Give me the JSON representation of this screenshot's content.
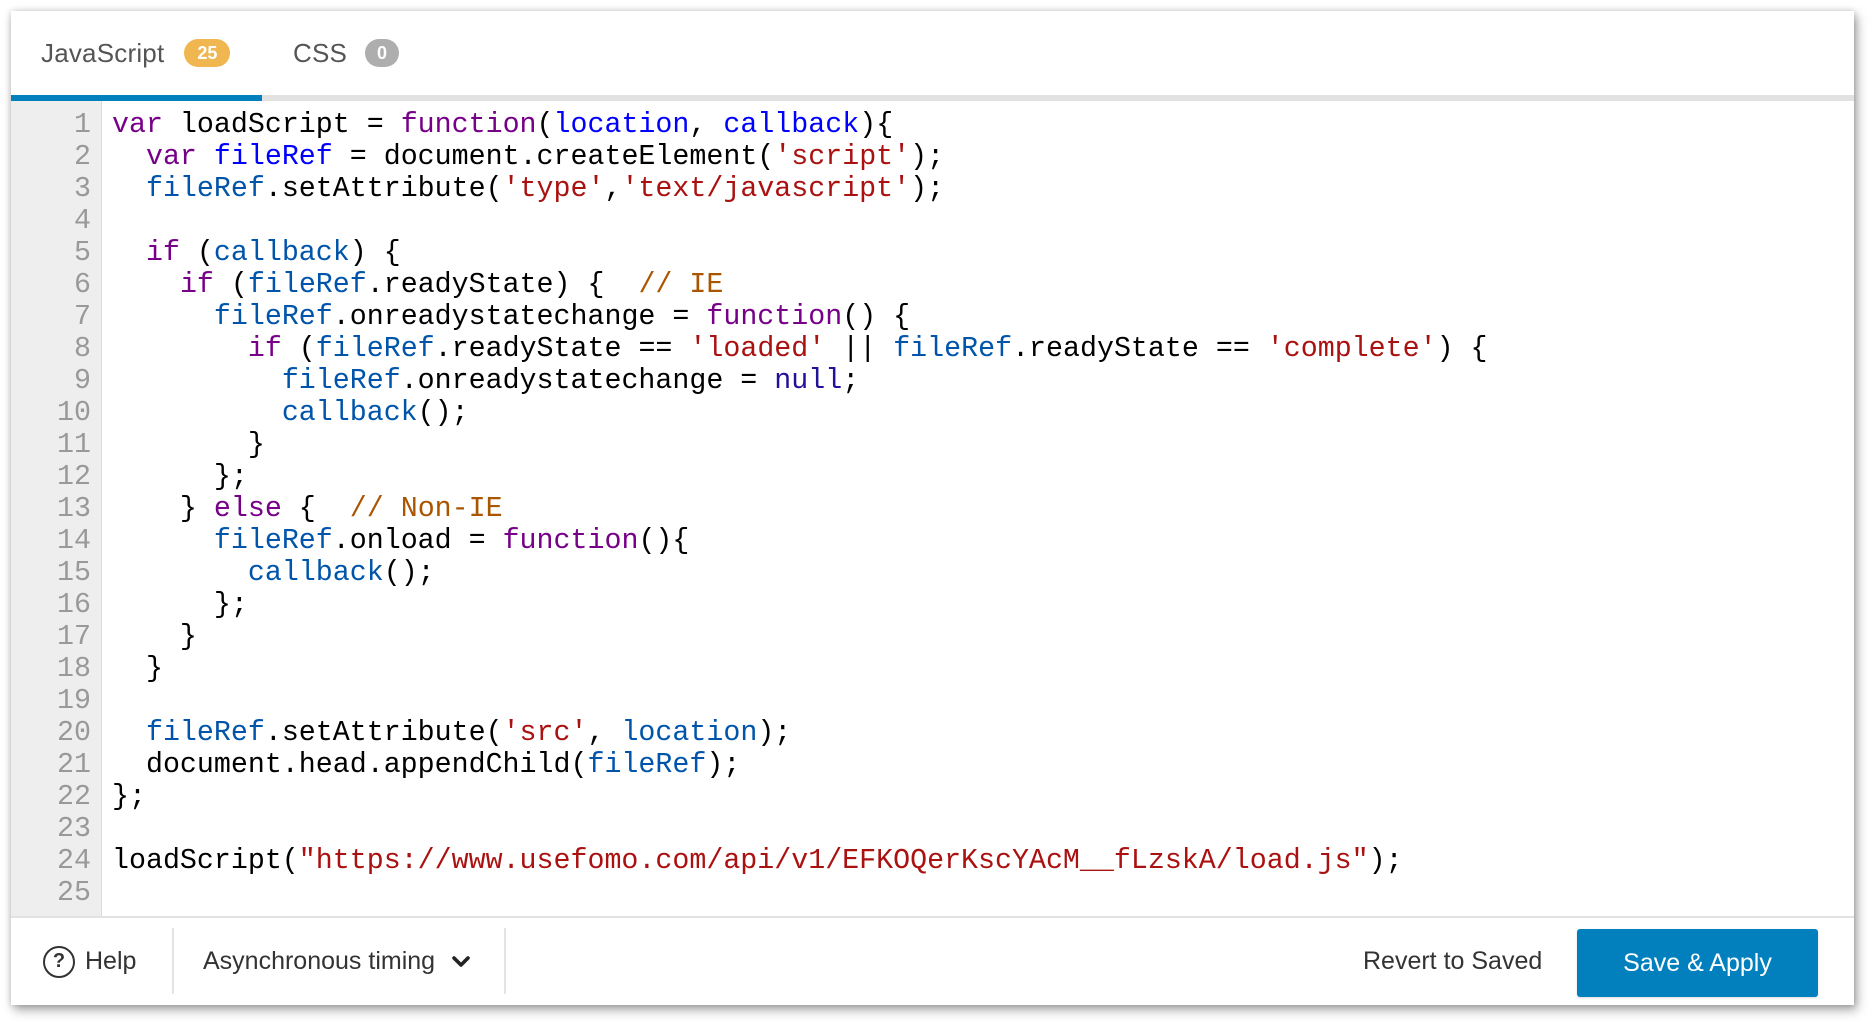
{
  "tabs": [
    {
      "label": "JavaScript",
      "badge": "25",
      "active": true
    },
    {
      "label": "CSS",
      "badge": "0",
      "active": false
    }
  ],
  "colors": {
    "accent": "#0180bd",
    "badge_js": "#f0b64f",
    "badge_css": "#aeaeae",
    "keyword": "#770088",
    "def": "#0000ff",
    "variable2": "#0055aa",
    "string": "#aa1111",
    "comment": "#aa5500",
    "atom": "#221199"
  },
  "editor": {
    "lines": [
      [
        [
          "keyword",
          "var"
        ],
        [
          "plain",
          " loadScript = "
        ],
        [
          "keyword",
          "function"
        ],
        [
          "plain",
          "("
        ],
        [
          "def",
          "location"
        ],
        [
          "plain",
          ", "
        ],
        [
          "def",
          "callback"
        ],
        [
          "plain",
          "){"
        ]
      ],
      [
        [
          "plain",
          "  "
        ],
        [
          "keyword",
          "var"
        ],
        [
          "plain",
          " "
        ],
        [
          "def",
          "fileRef"
        ],
        [
          "plain",
          " = document.createElement("
        ],
        [
          "string",
          "'script'"
        ],
        [
          "plain",
          ");"
        ]
      ],
      [
        [
          "plain",
          "  "
        ],
        [
          "var2",
          "fileRef"
        ],
        [
          "plain",
          ".setAttribute("
        ],
        [
          "string",
          "'type'"
        ],
        [
          "plain",
          ","
        ],
        [
          "string",
          "'text/javascript'"
        ],
        [
          "plain",
          ");"
        ]
      ],
      [],
      [
        [
          "plain",
          "  "
        ],
        [
          "keyword",
          "if"
        ],
        [
          "plain",
          " ("
        ],
        [
          "var2",
          "callback"
        ],
        [
          "plain",
          ") {"
        ]
      ],
      [
        [
          "plain",
          "    "
        ],
        [
          "keyword",
          "if"
        ],
        [
          "plain",
          " ("
        ],
        [
          "var2",
          "fileRef"
        ],
        [
          "plain",
          ".readyState) {  "
        ],
        [
          "comment",
          "// IE"
        ]
      ],
      [
        [
          "plain",
          "      "
        ],
        [
          "var2",
          "fileRef"
        ],
        [
          "plain",
          ".onreadystatechange = "
        ],
        [
          "keyword",
          "function"
        ],
        [
          "plain",
          "() {"
        ]
      ],
      [
        [
          "plain",
          "        "
        ],
        [
          "keyword",
          "if"
        ],
        [
          "plain",
          " ("
        ],
        [
          "var2",
          "fileRef"
        ],
        [
          "plain",
          ".readyState == "
        ],
        [
          "string",
          "'loaded'"
        ],
        [
          "plain",
          " || "
        ],
        [
          "var2",
          "fileRef"
        ],
        [
          "plain",
          ".readyState == "
        ],
        [
          "string",
          "'complete'"
        ],
        [
          "plain",
          ") {"
        ]
      ],
      [
        [
          "plain",
          "          "
        ],
        [
          "var2",
          "fileRef"
        ],
        [
          "plain",
          ".onreadystatechange = "
        ],
        [
          "atom",
          "null"
        ],
        [
          "plain",
          ";"
        ]
      ],
      [
        [
          "plain",
          "          "
        ],
        [
          "var2",
          "callback"
        ],
        [
          "plain",
          "();"
        ]
      ],
      [
        [
          "plain",
          "        }"
        ]
      ],
      [
        [
          "plain",
          "      };"
        ]
      ],
      [
        [
          "plain",
          "    } "
        ],
        [
          "keyword",
          "else"
        ],
        [
          "plain",
          " {  "
        ],
        [
          "comment",
          "// Non-IE"
        ]
      ],
      [
        [
          "plain",
          "      "
        ],
        [
          "var2",
          "fileRef"
        ],
        [
          "plain",
          ".onload = "
        ],
        [
          "keyword",
          "function"
        ],
        [
          "plain",
          "(){"
        ]
      ],
      [
        [
          "plain",
          "        "
        ],
        [
          "var2",
          "callback"
        ],
        [
          "plain",
          "();"
        ]
      ],
      [
        [
          "plain",
          "      };"
        ]
      ],
      [
        [
          "plain",
          "    }"
        ]
      ],
      [
        [
          "plain",
          "  }"
        ]
      ],
      [],
      [
        [
          "plain",
          "  "
        ],
        [
          "var2",
          "fileRef"
        ],
        [
          "plain",
          ".setAttribute("
        ],
        [
          "string",
          "'src'"
        ],
        [
          "plain",
          ", "
        ],
        [
          "var2",
          "location"
        ],
        [
          "plain",
          ");"
        ]
      ],
      [
        [
          "plain",
          "  document.head.appendChild("
        ],
        [
          "var2",
          "fileRef"
        ],
        [
          "plain",
          ");"
        ]
      ],
      [
        [
          "plain",
          "};"
        ]
      ],
      [],
      [
        [
          "plain",
          "loadScript("
        ],
        [
          "string",
          "\"https://www.usefomo.com/api/v1/EFKOQerKscYAcM__fLzskA/load.js\""
        ],
        [
          "plain",
          ");"
        ]
      ],
      []
    ]
  },
  "footer": {
    "help_icon": "question-circle-icon",
    "help_label": "Help",
    "timing_label": "Asynchronous timing",
    "timing_icon": "chevron-down-icon",
    "revert_label": "Revert to Saved",
    "save_label": "Save & Apply"
  }
}
